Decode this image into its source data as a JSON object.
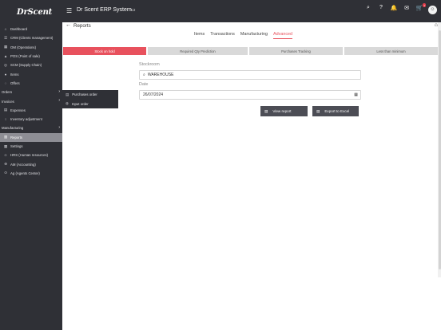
{
  "app": {
    "logo_text": "DrScent",
    "title": "Dr Scent ERP System"
  },
  "topbar": {
    "icons": [
      {
        "name": "search-icon",
        "glyph": "⌕"
      },
      {
        "name": "help-icon",
        "glyph": "?"
      },
      {
        "name": "bell-icon",
        "glyph": "🔔"
      },
      {
        "name": "mail-icon",
        "glyph": "✉"
      },
      {
        "name": "cart-icon",
        "glyph": "🛒",
        "badge": "1"
      }
    ]
  },
  "sidebar": {
    "items": [
      {
        "label": "Dashboard",
        "icon": "home-icon",
        "glyph": "⌂"
      },
      {
        "label": "CRM (Clients management)",
        "icon": "users-icon",
        "glyph": "☰"
      },
      {
        "label": "OM (Operations)",
        "icon": "grid-icon",
        "glyph": "▦"
      },
      {
        "label": "POS (Point of sale)",
        "icon": "bag-icon",
        "glyph": "▲"
      },
      {
        "label": "SCM (Supply Chain)",
        "icon": "chain-icon",
        "glyph": "◎"
      },
      {
        "label": "Items",
        "icon": "circle-icon",
        "glyph": "●"
      },
      {
        "label": "Offers",
        "icon": "tag-icon",
        "glyph": "◌"
      },
      {
        "label": "Orders",
        "icon": "",
        "glyph": "",
        "group": true
      },
      {
        "label": "Invoices",
        "icon": "",
        "glyph": "",
        "group": true
      },
      {
        "label": "Expenses",
        "icon": "receipt-icon",
        "glyph": "▤"
      },
      {
        "label": "Inventory adjustment",
        "icon": "adjust-icon",
        "glyph": "↕"
      },
      {
        "label": "Manufacturing",
        "icon": "",
        "glyph": "",
        "group": true
      },
      {
        "label": "Reports",
        "icon": "report-icon",
        "glyph": "▥",
        "active": true
      },
      {
        "label": "Settings",
        "icon": "settings-icon",
        "glyph": "▦"
      },
      {
        "label": "HRS (Human resources)",
        "icon": "person-icon",
        "glyph": "☺"
      },
      {
        "label": "AM (Accounting)",
        "icon": "account-icon",
        "glyph": "⊕"
      },
      {
        "label": "Ag (Agents Center)",
        "icon": "agent-icon",
        "glyph": "⊙"
      }
    ]
  },
  "flyout": {
    "items": [
      {
        "label": "Purchases order",
        "glyph": "▤"
      },
      {
        "label": "Input order",
        "glyph": "◍"
      }
    ]
  },
  "page": {
    "title": "Reports"
  },
  "tabs": [
    {
      "label": "Items",
      "active": false
    },
    {
      "label": "Transactions",
      "active": false
    },
    {
      "label": "Manufacturing",
      "active": false
    },
    {
      "label": "Advanced",
      "active": true
    }
  ],
  "subtabs": [
    {
      "label": "Stock on hold",
      "active": true
    },
    {
      "label": "Required Qty Prediction",
      "active": false
    },
    {
      "label": "Purchases Tracking",
      "active": false
    },
    {
      "label": "Less than minimum",
      "active": false
    }
  ],
  "form": {
    "stockroom_label": "Stockroom",
    "stockroom_value": "WAREHOUSE",
    "date_label": "Date",
    "date_value": "26/07/2024"
  },
  "buttons": {
    "view_report": "View report",
    "export_excel": "Export to Excel"
  },
  "colors": {
    "accent": "#e8515d",
    "sidebar_bg": "#2f3036",
    "button_bg": "#4c4d55"
  }
}
